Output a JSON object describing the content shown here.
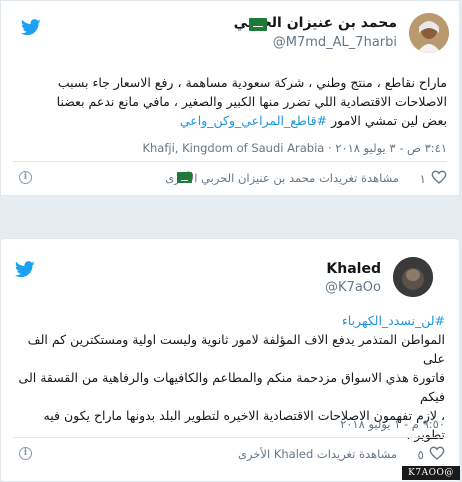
{
  "tweets": [
    {
      "author_name": "محمد بن عنيزان الحربي",
      "handle": "@M7md_AL_7harbi",
      "text_lines": [
        "ماراح نقاطع ، منتج وطني ، شركة سعودية مساهمة ، رفع الاسعار جاء بسبب",
        "الاصلاحات الاقتصادية اللي تضرر منها الكبير والصغير ، مافي مانع ندعم بعضنا",
        "بعض لين تمشي الامور"
      ],
      "hashtags": [
        "#قاطع_المراعي_وكن_واعي"
      ],
      "timestamp": "٣:٤١ ص - ٣ يوليو ٢٠١٨",
      "location": "Khafji, Kingdom of Saudi Arabia",
      "more_link": "مشاهدة تغريدات محمد بن عنيزان الحربي الأخرى",
      "like_count": "١"
    },
    {
      "author_name": "Khaled",
      "handle": "@K7aOo",
      "hashtag_top": "#لن_نسدد_الكهرباء",
      "text_lines": [
        "المواطن المتذمر يدفع الاف المؤلفة لامور ثانوية وليست اولية ومستكترين كم الف على",
        "فاتورة هذي الاسواق مزدحمة منكم والمطاعم والكافيهات والرفاهية من القسقة الى فيكم",
        "، لازم تفهمون الاصلاحات الاقتصادية الاخيره لتطوير البلد بدونها ماراح يكون فيه",
        "تطوير ."
      ],
      "timestamp": "٩:٥٠ م - ١ يوليو ٢٠١٨",
      "more_link": "مشاهدة تغريدات Khaled الأخرى",
      "like_count": "٥"
    }
  ],
  "watermark": "K7AOO@",
  "colors": {
    "twitter_blue": "#1da1f2",
    "hashtag_blue": "#1b95e0",
    "muted": "#657786",
    "flag_green": "#1f7a3a"
  },
  "icons": [
    "twitter-bird-icon",
    "saudi-flag-icon",
    "heart-icon",
    "info-icon"
  ]
}
